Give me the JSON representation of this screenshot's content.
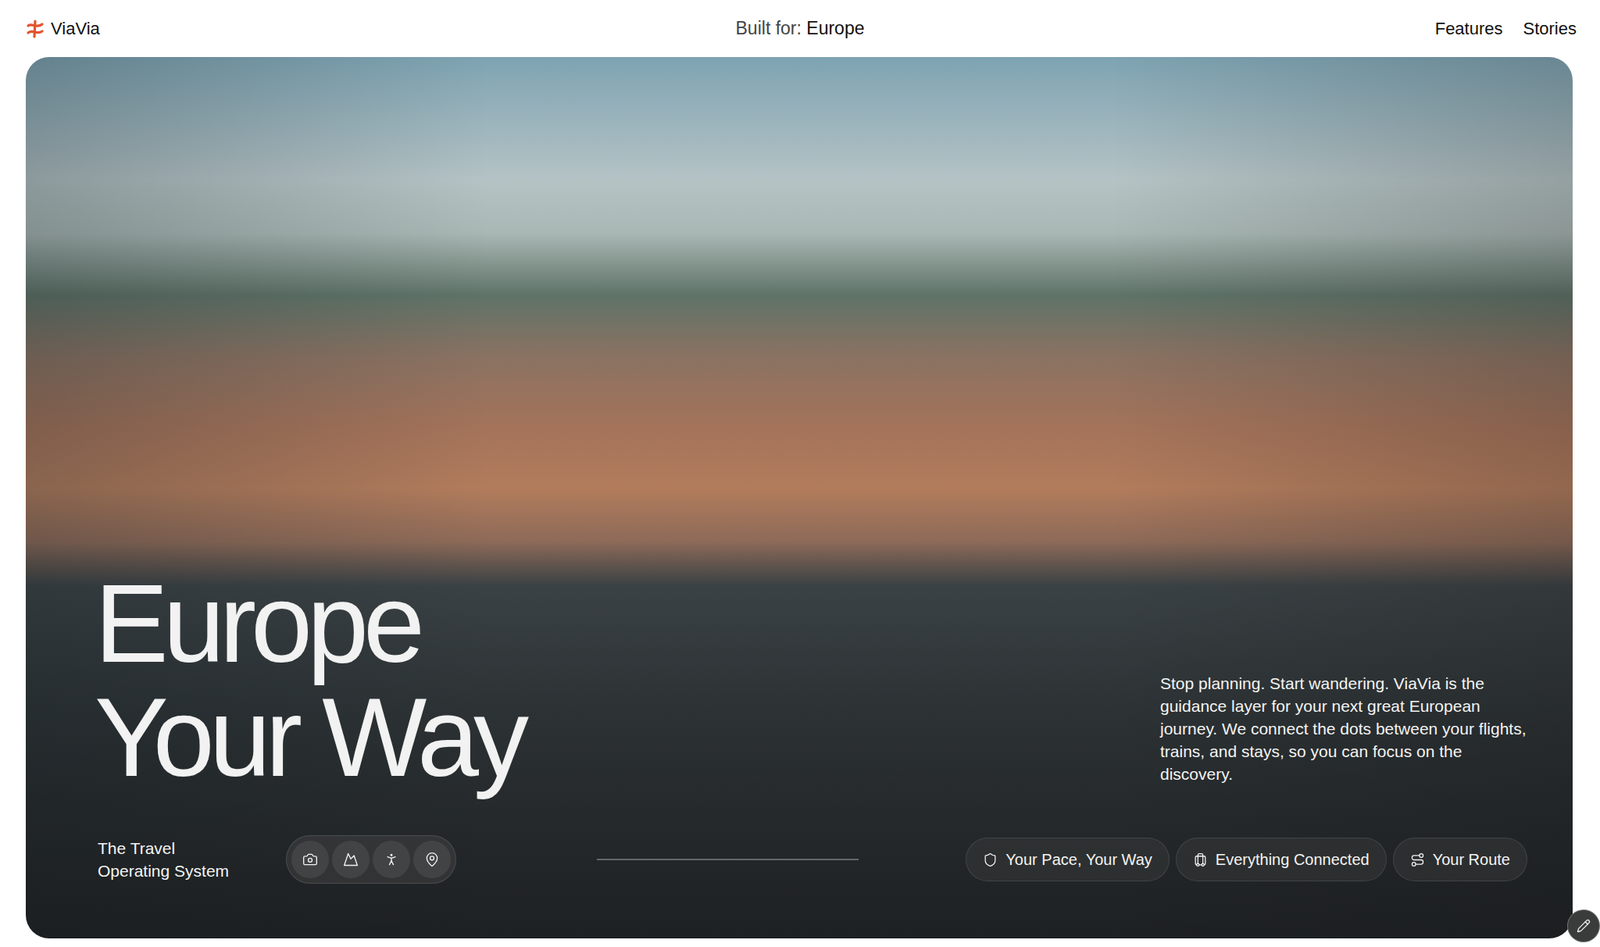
{
  "header": {
    "logo": "ViaVia",
    "built_for_label": "Built for:",
    "built_for_value": "Europe",
    "nav": [
      "Features",
      "Stories"
    ]
  },
  "hero": {
    "title": [
      "Europe",
      "Your Way"
    ],
    "tagline": [
      "The Travel",
      "Operating System"
    ],
    "description": "Stop planning. Start wandering. ViaVia is the guidance layer for your next great European journey. We connect the dots between your flights, trains, and stays, so you can focus on the discovery.",
    "chips": [
      {
        "label": "Your Pace, Your Way"
      },
      {
        "label": "Everything Connected"
      },
      {
        "label": "Your Route"
      }
    ]
  }
}
